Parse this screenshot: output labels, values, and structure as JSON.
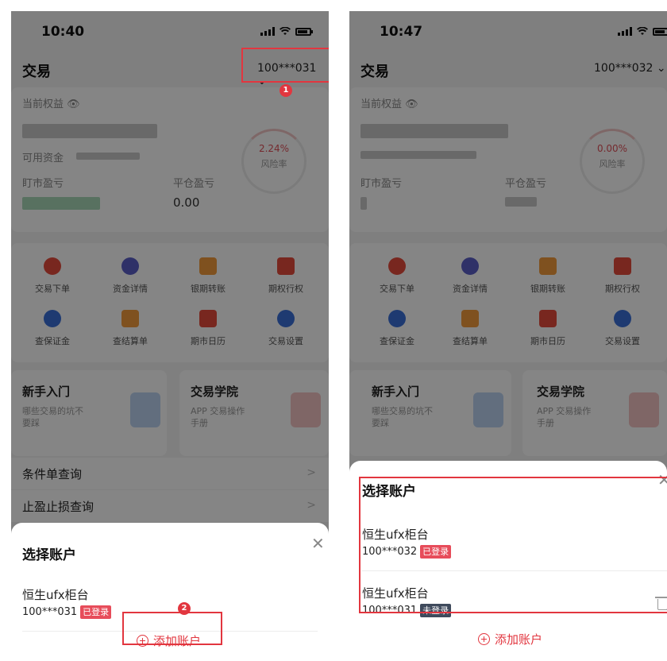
{
  "left": {
    "status": {
      "time": "10:40"
    },
    "header": {
      "title": "交易",
      "account": "100***031 ⌄"
    },
    "equity": {
      "label": "当前权益 👁",
      "available": "可用资金",
      "risk_value": "2.24%",
      "risk_label": "风险率"
    },
    "pnl": {
      "floating_label": "盯市盈亏",
      "closing_label": "平仓盈亏",
      "closing_value": "0.00"
    },
    "menu": [
      {
        "label": "交易下单"
      },
      {
        "label": "资金详情"
      },
      {
        "label": "银期转账"
      },
      {
        "label": "期权行权"
      },
      {
        "label": "查保证金"
      },
      {
        "label": "查结算单"
      },
      {
        "label": "期市日历"
      },
      {
        "label": "交易设置"
      }
    ],
    "promos": [
      {
        "title": "新手入门",
        "sub1": "哪些交易的坑不",
        "sub2": "要踩"
      },
      {
        "title": "交易学院",
        "sub1": "APP 交易操作",
        "sub2": "手册"
      }
    ],
    "rows": [
      {
        "label": "条件单查询",
        "arrow": ">"
      },
      {
        "label": "止盈止损查询",
        "arrow": ">"
      }
    ],
    "sheet": {
      "title": "选择账户",
      "close": "✕",
      "accounts": [
        {
          "name": "恒生ufx柜台",
          "number": "100***031",
          "badge": "已登录"
        }
      ],
      "add": "添加账户"
    },
    "markers": [
      "1",
      "2"
    ]
  },
  "right": {
    "status": {
      "time": "10:47"
    },
    "header": {
      "title": "交易",
      "account": "100***032 ⌄"
    },
    "equity": {
      "label": "当前权益 👁",
      "risk_value": "0.00%",
      "risk_label": "风险率"
    },
    "pnl": {
      "floating_label": "盯市盈亏",
      "closing_label": "平仓盈亏"
    },
    "menu": [
      {
        "label": "交易下单"
      },
      {
        "label": "资金详情"
      },
      {
        "label": "银期转账"
      },
      {
        "label": "期权行权"
      },
      {
        "label": "查保证金"
      },
      {
        "label": "查结算单"
      },
      {
        "label": "期市日历"
      },
      {
        "label": "交易设置"
      }
    ],
    "promos": [
      {
        "title": "新手入门",
        "sub1": "哪些交易的坑不",
        "sub2": "要踩"
      },
      {
        "title": "交易学院",
        "sub1": "APP 交易操作",
        "sub2": "手册"
      }
    ],
    "sheet": {
      "title": "选择账户",
      "close": "✕",
      "accounts": [
        {
          "name": "恒生ufx柜台",
          "number": "100***032",
          "badge": "已登录"
        },
        {
          "name": "恒生ufx柜台",
          "number": "100***031",
          "badge": "未登录"
        }
      ],
      "add": "添加账户"
    }
  },
  "colors": {
    "accent": "#e2363f",
    "badge_on": "#e74c5a",
    "badge_off": "#3f4a5c"
  },
  "icons": [
    "signal-icon",
    "wifi-icon",
    "battery-icon",
    "eye-icon",
    "close-icon",
    "plus-circle-icon",
    "trash-icon",
    "chevron-right-icon",
    "chevron-down-icon"
  ]
}
